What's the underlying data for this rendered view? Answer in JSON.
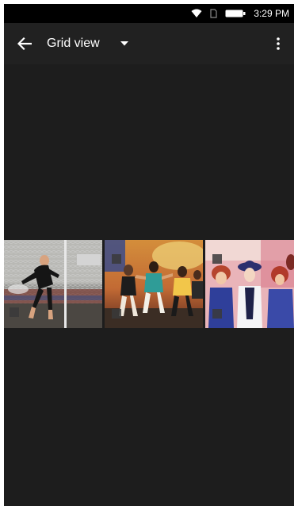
{
  "status_bar": {
    "time": "3:29 PM",
    "icons": [
      "wifi-icon",
      "sim-icon",
      "battery-icon"
    ]
  },
  "app_bar": {
    "title": "Grid view",
    "icons": [
      "back-arrow-icon",
      "dropdown-caret-icon",
      "more-vert-icon"
    ]
  },
  "grid": {
    "items": [
      {
        "name": "soccer-goalkeeper-photo"
      },
      {
        "name": "dancers-stage-photo"
      },
      {
        "name": "performers-pink-stage-photo"
      }
    ]
  },
  "colors": {
    "background": "#1d1d1d",
    "app_bar": "#212121",
    "status_bar": "#000000",
    "text": "#ffffff"
  }
}
